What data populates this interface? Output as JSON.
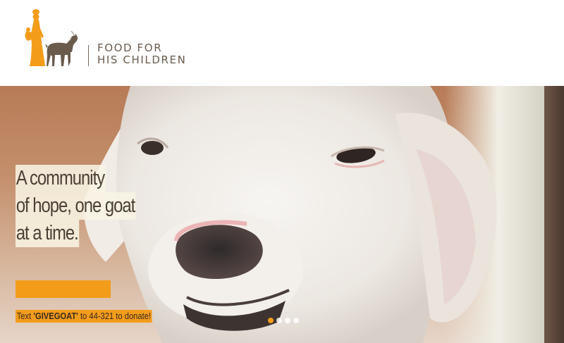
{
  "brand": {
    "line1": "FOOD FOR",
    "line2": "HIS CHILDREN",
    "colors": {
      "woman": "#f39c1a",
      "goat": "#6b5b4d",
      "text": "#6b5b4d"
    }
  },
  "hero": {
    "tagline": [
      "A community",
      "of hope, one goat",
      "at a time."
    ],
    "donate_button_label": "",
    "text_to_give": {
      "prefix": "Text ",
      "keyword": "'GIVEGOAT'",
      "suffix": " to 44-321 to donate!"
    },
    "slides": {
      "count": 4,
      "active_index": 0
    }
  },
  "colors": {
    "accent": "#f39c1a",
    "tagline_text": "#4a3f35"
  }
}
